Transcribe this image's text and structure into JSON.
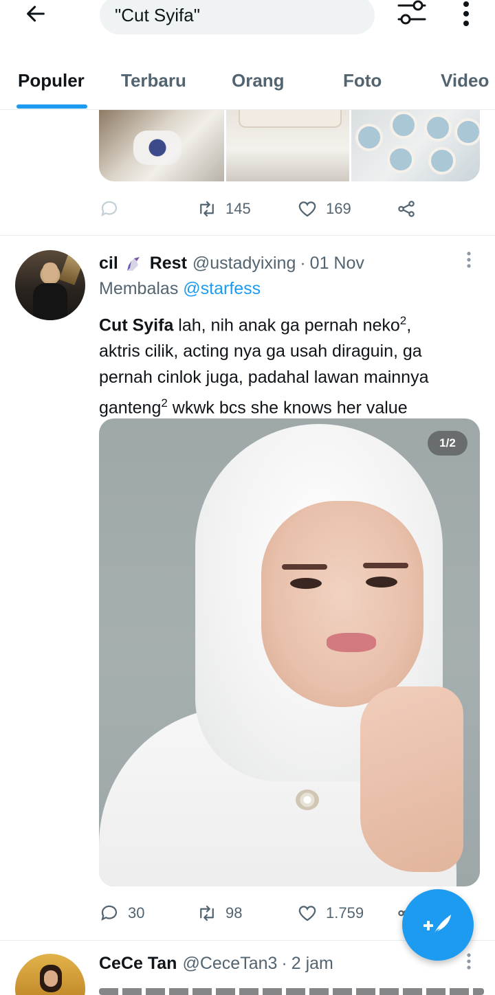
{
  "search": {
    "query": "\"Cut Syifa\""
  },
  "tabs": [
    {
      "label": "Populer"
    },
    {
      "label": "Terbaru"
    },
    {
      "label": "Orang"
    },
    {
      "label": "Foto"
    },
    {
      "label": "Video"
    }
  ],
  "active_tab": "Populer",
  "prev_tweet": {
    "retweets": "145",
    "likes": "169"
  },
  "tweet": {
    "name_part1": "cil",
    "name_emoji": "unicorn-emoji",
    "name_part2": "Rest",
    "handle": "@ustadyixing",
    "separator": "·",
    "date": "01 Nov",
    "reply_prefix": "Membalas",
    "reply_mention": "@starfess",
    "text_bold": "Cut Syifa",
    "text_line1_rest": " lah, nih anak ga pernah neko",
    "sup1": "2",
    "text_line1_end": ",",
    "text_line2": "aktris cilik, acting nya ga usah diraguin, ga",
    "text_line3": "pernah cinlok juga, padahal lawan mainnya",
    "text_line4_start": "ganteng",
    "sup2": "2",
    "text_line4_rest": " wkwk bcs she knows her value",
    "photo_counter": "1/2",
    "replies": "30",
    "retweets": "98",
    "likes": "1.759"
  },
  "next_tweet": {
    "name": "CeCe Tan",
    "handle": "@CeceTan3",
    "separator": "·",
    "time": "2 jam"
  },
  "colors": {
    "accent": "#1d9bf0",
    "text_primary": "#0f1419",
    "text_secondary": "#536471",
    "divider": "#e6ecf0"
  },
  "icons": {
    "back": "arrow-left-icon",
    "filter": "sliders-icon",
    "more": "vertical-ellipsis-icon",
    "reply": "speech-bubble-icon",
    "retweet": "retweet-icon",
    "like": "heart-icon",
    "share": "share-icon",
    "compose": "feather-plus-icon"
  }
}
